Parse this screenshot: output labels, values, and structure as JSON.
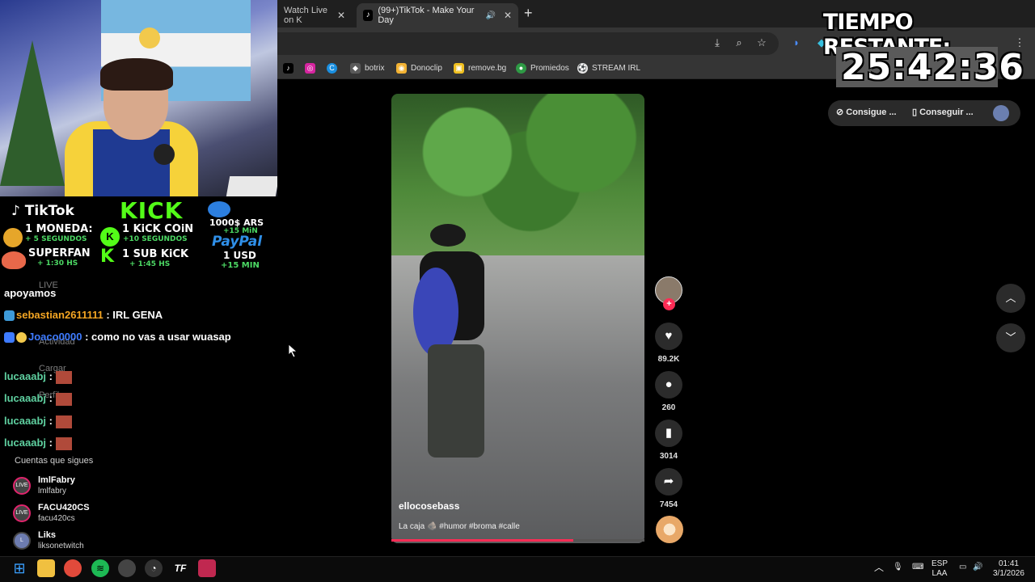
{
  "browser": {
    "tabs": [
      {
        "label": "Watch Live on K",
        "active": false
      },
      {
        "label": "(99+)TikTok - Make Your Day",
        "active": true
      }
    ],
    "icons": [
      "close-icon",
      "speaker-icon",
      "plus-icon",
      "install-icon",
      "zoom-icon",
      "star-icon",
      "extension-icon",
      "download-icon",
      "menu-dots-icon"
    ],
    "bookmarks": [
      {
        "label": "botrix",
        "icon": "diamond-icon",
        "color": "#5a5a5a"
      },
      {
        "label": "Donoclip",
        "icon": "donoclip-icon",
        "color": "#f2b233"
      },
      {
        "label": "remove.bg",
        "icon": "removebg-icon",
        "color": "#f0c020"
      },
      {
        "label": "Promiedos",
        "icon": "promiedos-icon",
        "color": "#2e9a45"
      },
      {
        "label": "STREAM IRL",
        "icon": "soccer-ball-icon",
        "color": "#e8e8e8"
      }
    ]
  },
  "tiktok": {
    "pill": {
      "coins": "Consigue ...",
      "app": "Conseguir ..."
    },
    "video": {
      "username": "ellocosebass",
      "caption": "La caja 🪨 #humor #broma #calle",
      "progress": 0.72
    },
    "actions": {
      "likes": "89.2K",
      "comments": "260",
      "saves": "3014",
      "shares": "7454"
    }
  },
  "overlay": {
    "timer": {
      "label": "TIEMPO RESTANTE:",
      "value": "25:42:36"
    },
    "donations": {
      "tiktok_brand": "TikTok",
      "kick_brand": "KICK",
      "tiktok_coin": "1 MONEDA:",
      "tiktok_coin_time": "+ 5 SEGUNDOS",
      "superfan": "SUPERFAN",
      "superfan_time": "+ 1:30 HS",
      "kick_coin": "1 KiCK COiN",
      "kick_coin_time": "+10 SEGUNDOS",
      "kick_sub": "1 SUB KiCK",
      "kick_sub_time": "+ 1:45 HS",
      "ars": "1000$ ARS",
      "ars_time": "+15 MiN",
      "paypal": "PayPal",
      "usd": "1 USD",
      "usd_time": "+15 MIN"
    },
    "chat": [
      {
        "user": "",
        "text": "apoyamos"
      },
      {
        "user": "sebastian2611111",
        "text": " : IRL GENA"
      },
      {
        "user": "Joaco0000",
        "text": " : como no vas a usar wuasap"
      },
      {
        "user": "lucaaabj",
        "text": " :"
      },
      {
        "user": "lucaaabj",
        "text": " :"
      },
      {
        "user": "lucaaabj",
        "text": " :"
      },
      {
        "user": "lucaaabj",
        "text": " :"
      }
    ],
    "ghost_sidebar": [
      "LIVE",
      "Actividad",
      "Cargar",
      "Perfil"
    ]
  },
  "following": {
    "header": "Cuentas que sigues",
    "accounts": [
      {
        "name": "lmlFabry",
        "handle": "lmlfabry",
        "badge": "LIVE"
      },
      {
        "name": "FACU420CS",
        "handle": "facu420cs",
        "badge": "LIVE"
      },
      {
        "name": "Liks",
        "handle": "liksonetwitch",
        "badge": "L"
      }
    ]
  },
  "taskbar": {
    "lang_top": "ESP",
    "lang_bottom": "LAA",
    "time": "01:41",
    "date": "3/1/2026"
  }
}
